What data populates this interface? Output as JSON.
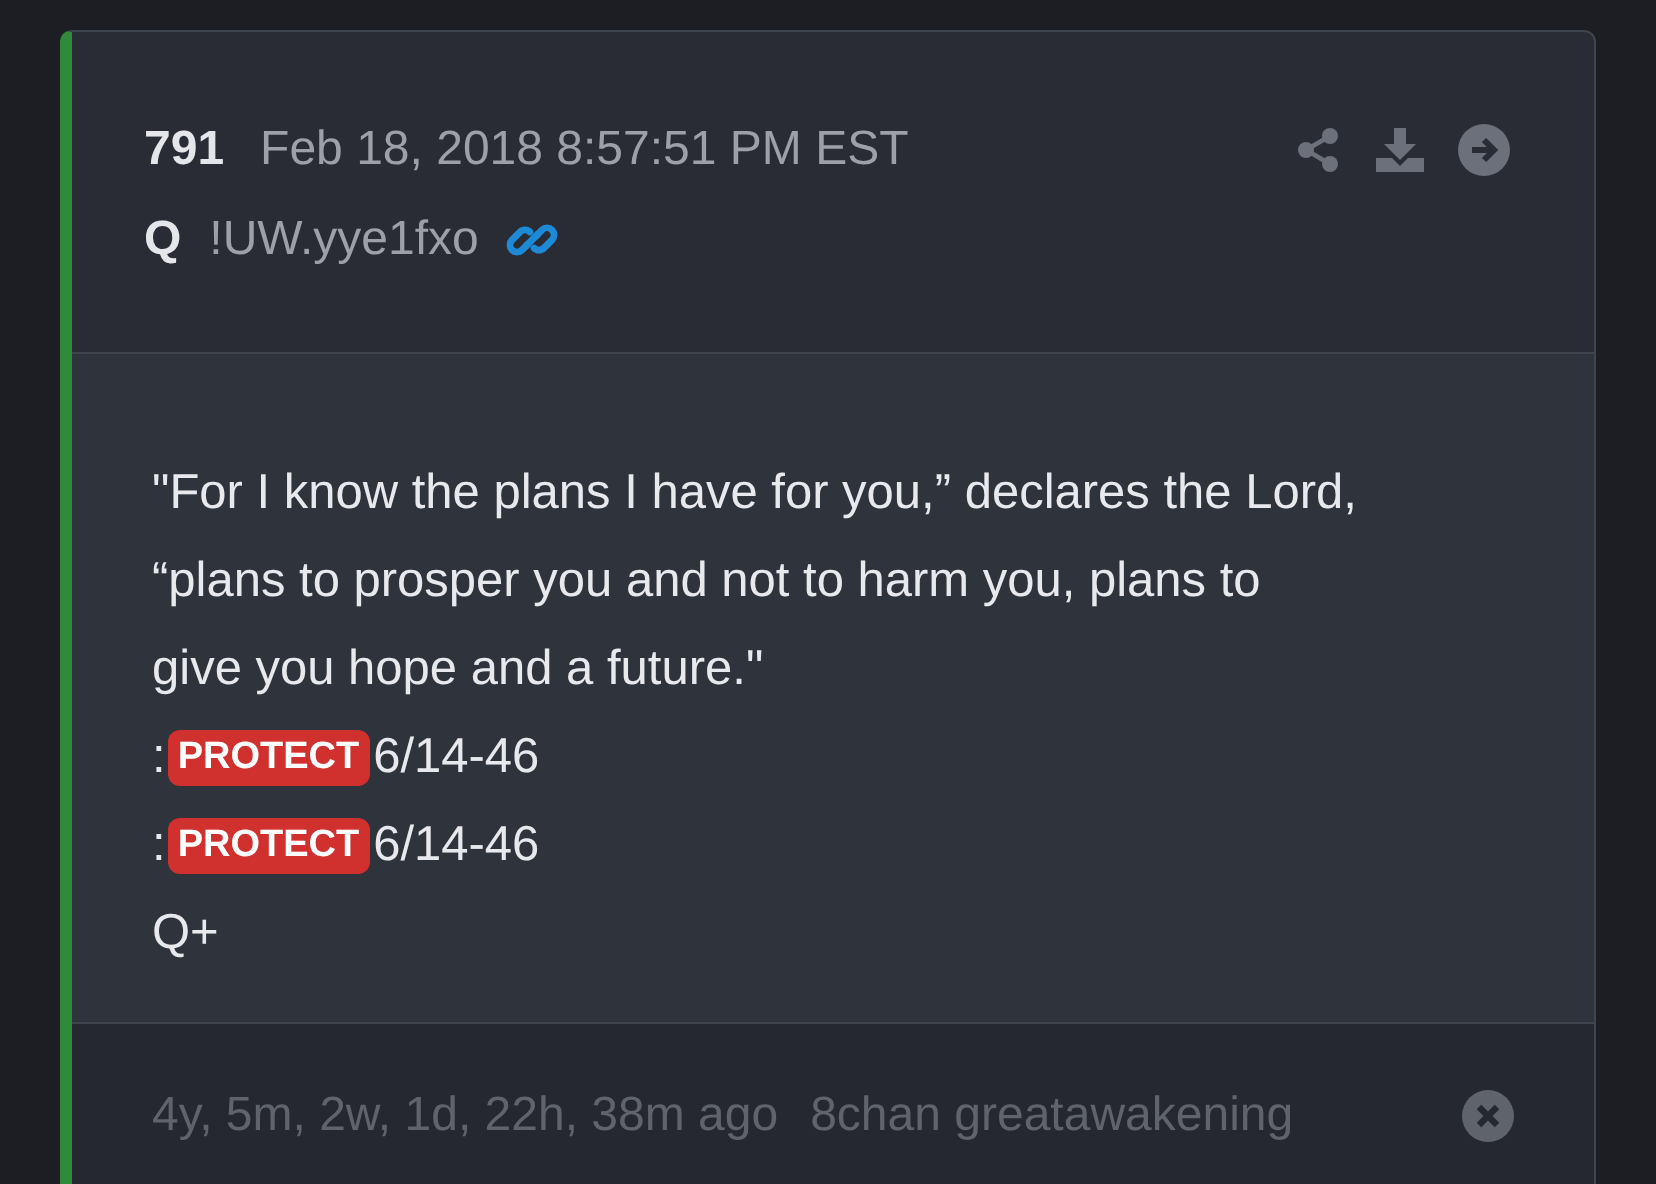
{
  "post": {
    "number": "791",
    "date": "Feb 18, 2018 8:57:51 PM EST",
    "author": "Q",
    "tripcode": "!UW.yye1fxo"
  },
  "body": {
    "lines": [
      {
        "kind": "text",
        "text": "\"For I know the plans I have for you,” declares the Lord,"
      },
      {
        "kind": "text",
        "text": "“plans to prosper you and not to harm you, plans to"
      },
      {
        "kind": "text",
        "text": "give you hope and a future.\""
      },
      {
        "kind": "tagged",
        "prefix": ":",
        "tag": "PROTECT",
        "text": "6/14-46"
      },
      {
        "kind": "tagged",
        "prefix": ":",
        "tag": "PROTECT",
        "text": "6/14-46"
      },
      {
        "kind": "text",
        "text": "Q+"
      }
    ]
  },
  "footer": {
    "age": "4y, 5m, 2w, 1d, 22h, 38m ago",
    "source": "8chan greatawakening"
  }
}
